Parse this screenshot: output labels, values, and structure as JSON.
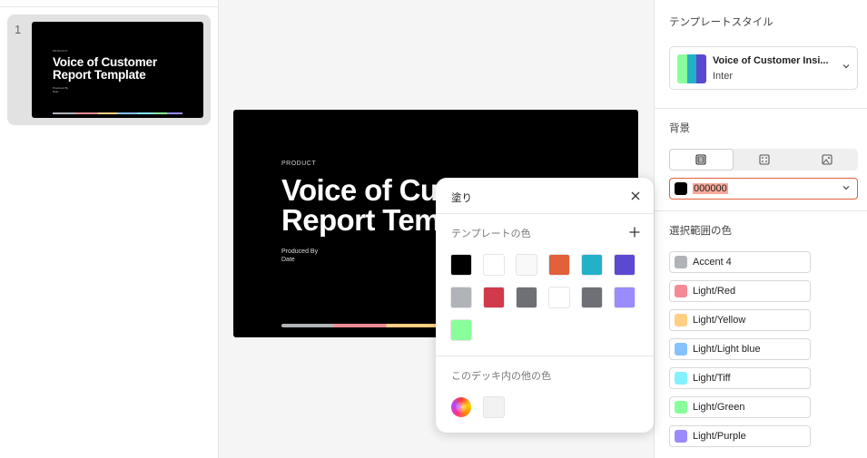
{
  "thumbnail": {
    "number": "1",
    "product": "PRODUCT",
    "title_line1": "Voice of Customer",
    "title_line2": "Report Template",
    "produced_by": "Produced By",
    "date": "Date"
  },
  "slide": {
    "product": "PRODUCT",
    "title_line1": "Voice of Cu",
    "title_line2": "Report Tem",
    "produced_by": "Produced By",
    "date": "Date"
  },
  "right_panel": {
    "template_style_label": "テンプレートスタイル",
    "style_name": "Voice of Customer Insi...",
    "style_font": "Inter",
    "style_swatch_colors": [
      "#88ff9b",
      "#23b1c7",
      "#5b49d1"
    ],
    "background_label": "背景",
    "background_tabs": [
      "solid-fill-icon",
      "pattern-icon",
      "image-icon"
    ],
    "background_value": "000000",
    "background_color": "#000000",
    "selection_colors_label": "選択範囲の色",
    "selection_colors": [
      {
        "label": "Accent 4",
        "color": "#b0b3b8"
      },
      {
        "label": "Light/Red",
        "color": "#f48a96"
      },
      {
        "label": "Light/Yellow",
        "color": "#ffcf84"
      },
      {
        "label": "Light/Light blue",
        "color": "#85c2ff"
      },
      {
        "label": "Light/Tiff",
        "color": "#84f1ff"
      },
      {
        "label": "Light/Green",
        "color": "#88ff9b"
      },
      {
        "label": "Light/Purple",
        "color": "#9a8bff"
      }
    ]
  },
  "popover": {
    "title": "塗り",
    "template_colors_label": "テンプレートの色",
    "template_colors": [
      "#000000",
      "#ffffff",
      "#f9f9f9",
      "#e2603a",
      "#23b1c7",
      "#5b49d1",
      "#b0b3b8",
      "#d03a4a",
      "#6e7075",
      "#ffffff",
      "#6e7075",
      "#9a8bff",
      "#88ff9b"
    ],
    "other_colors_label": "このデッキ内の他の色",
    "other_colors": [
      "#f2f2f2"
    ]
  }
}
